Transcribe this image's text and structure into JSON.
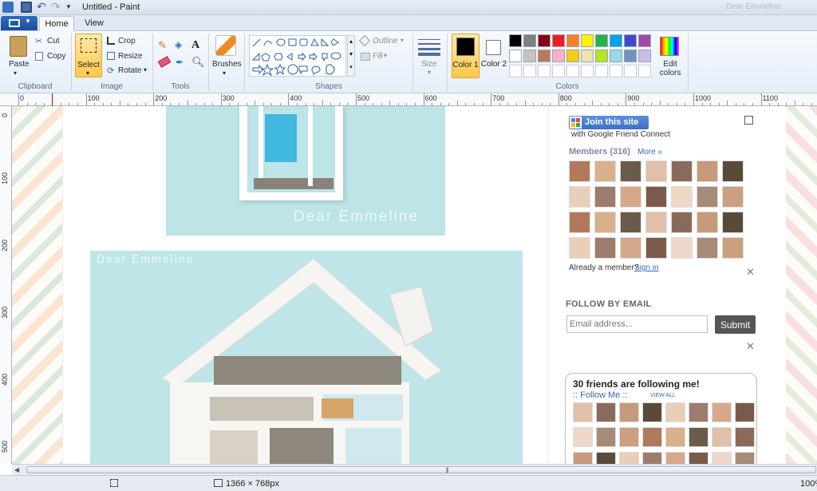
{
  "window": {
    "title": "Untitled - Paint",
    "ghost_tabs": [
      "Dear Emmeline"
    ]
  },
  "tabs": {
    "file": "",
    "home": "Home",
    "view": "View"
  },
  "ribbon": {
    "clipboard": {
      "label": "Clipboard",
      "paste": "Paste",
      "cut": "Cut",
      "copy": "Copy"
    },
    "image": {
      "label": "Image",
      "select": "Select",
      "crop": "Crop",
      "resize": "Resize",
      "rotate": "Rotate"
    },
    "tools": {
      "label": "Tools"
    },
    "brushes": {
      "label": "Brushes"
    },
    "shapes": {
      "label": "Shapes",
      "outline": "Outline",
      "fill": "Fill"
    },
    "size": {
      "label": "Size"
    },
    "colors": {
      "label": "Colors",
      "color1": "Color 1",
      "color2": "Color 2",
      "edit": "Edit colors",
      "color1_value": "#000000",
      "color2_value": "#ffffff",
      "palette_row1": [
        "#000000",
        "#7f7f7f",
        "#880015",
        "#ed1c24",
        "#ff7f27",
        "#fff200",
        "#22b14c",
        "#00a2e8",
        "#3f48cc",
        "#a349a4"
      ],
      "palette_row2": [
        "#ffffff",
        "#c3c3c3",
        "#b97a57",
        "#ffaec9",
        "#ffc90e",
        "#efe4b0",
        "#b5e61d",
        "#99d9ea",
        "#7092be",
        "#c8bfe7"
      ]
    }
  },
  "ruler": {
    "h_labels": [
      "0",
      "100",
      "200",
      "300",
      "400",
      "500",
      "600",
      "700",
      "800",
      "900",
      "1000",
      "1100"
    ],
    "v_labels": [
      "0",
      "100",
      "200",
      "300",
      "400",
      "500"
    ]
  },
  "canvas": {
    "watermark1": "Dear Emmeline",
    "watermark2": "Dear Emmeline",
    "sidebar": {
      "join": "Join this site",
      "join_sub": "with Google Friend Connect",
      "members": "Members (316)",
      "more": "More »",
      "already": "Already a member?",
      "signin": "Sign in",
      "follow_heading": "FOLLOW BY EMAIL",
      "email_placeholder": "Email address...",
      "submit": "Submit",
      "friends_title": "30 friends are following me!",
      "follow_me": ":: Follow Me ::",
      "view_all": "VIEW ALL"
    }
  },
  "status": {
    "dimensions": "1366 × 768px",
    "zoom": "100%"
  }
}
